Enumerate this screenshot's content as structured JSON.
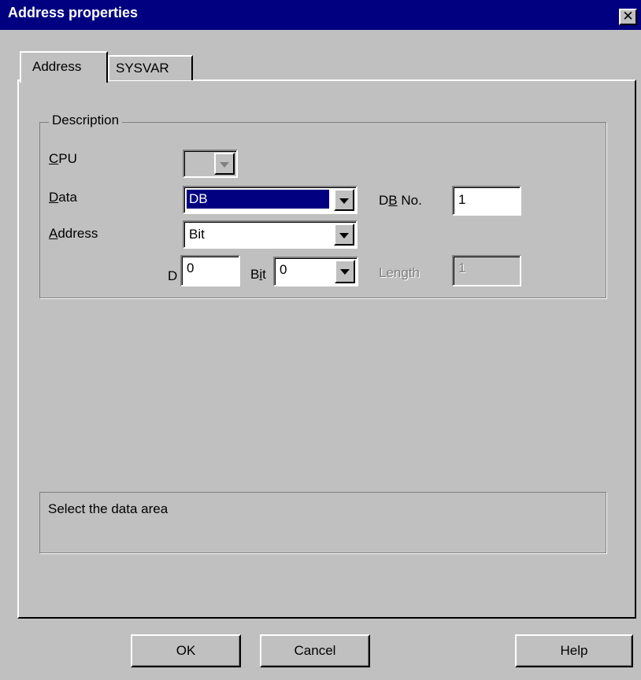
{
  "window": {
    "title": "Address properties",
    "close_glyph": "✕"
  },
  "tabs": [
    {
      "label": "Address",
      "active": true
    },
    {
      "label": "SYSVAR",
      "active": false
    }
  ],
  "description": {
    "group_label": "Description",
    "cpu": {
      "label_accel": "C",
      "label_rest": "PU",
      "value": ""
    },
    "data": {
      "label_accel": "D",
      "label_rest": "ata",
      "value": "DB"
    },
    "db_no": {
      "label_pre": "D",
      "label_accel": "B",
      "label_post": " No.",
      "value": "1"
    },
    "address": {
      "label_accel": "A",
      "label_rest": "ddress",
      "value": "Bit"
    },
    "d": {
      "label": "D",
      "value": "0"
    },
    "bit": {
      "label_pre": "B",
      "label_accel": "i",
      "label_post": "t",
      "value": "0"
    },
    "length": {
      "label": "Length",
      "value": "1"
    }
  },
  "info": {
    "text": "Select the data area"
  },
  "buttons": {
    "ok": "OK",
    "cancel": "Cancel",
    "help": "Help"
  },
  "colors": {
    "face": "#c0c0c0",
    "titlebar": "#000080",
    "selection": "#000080"
  }
}
